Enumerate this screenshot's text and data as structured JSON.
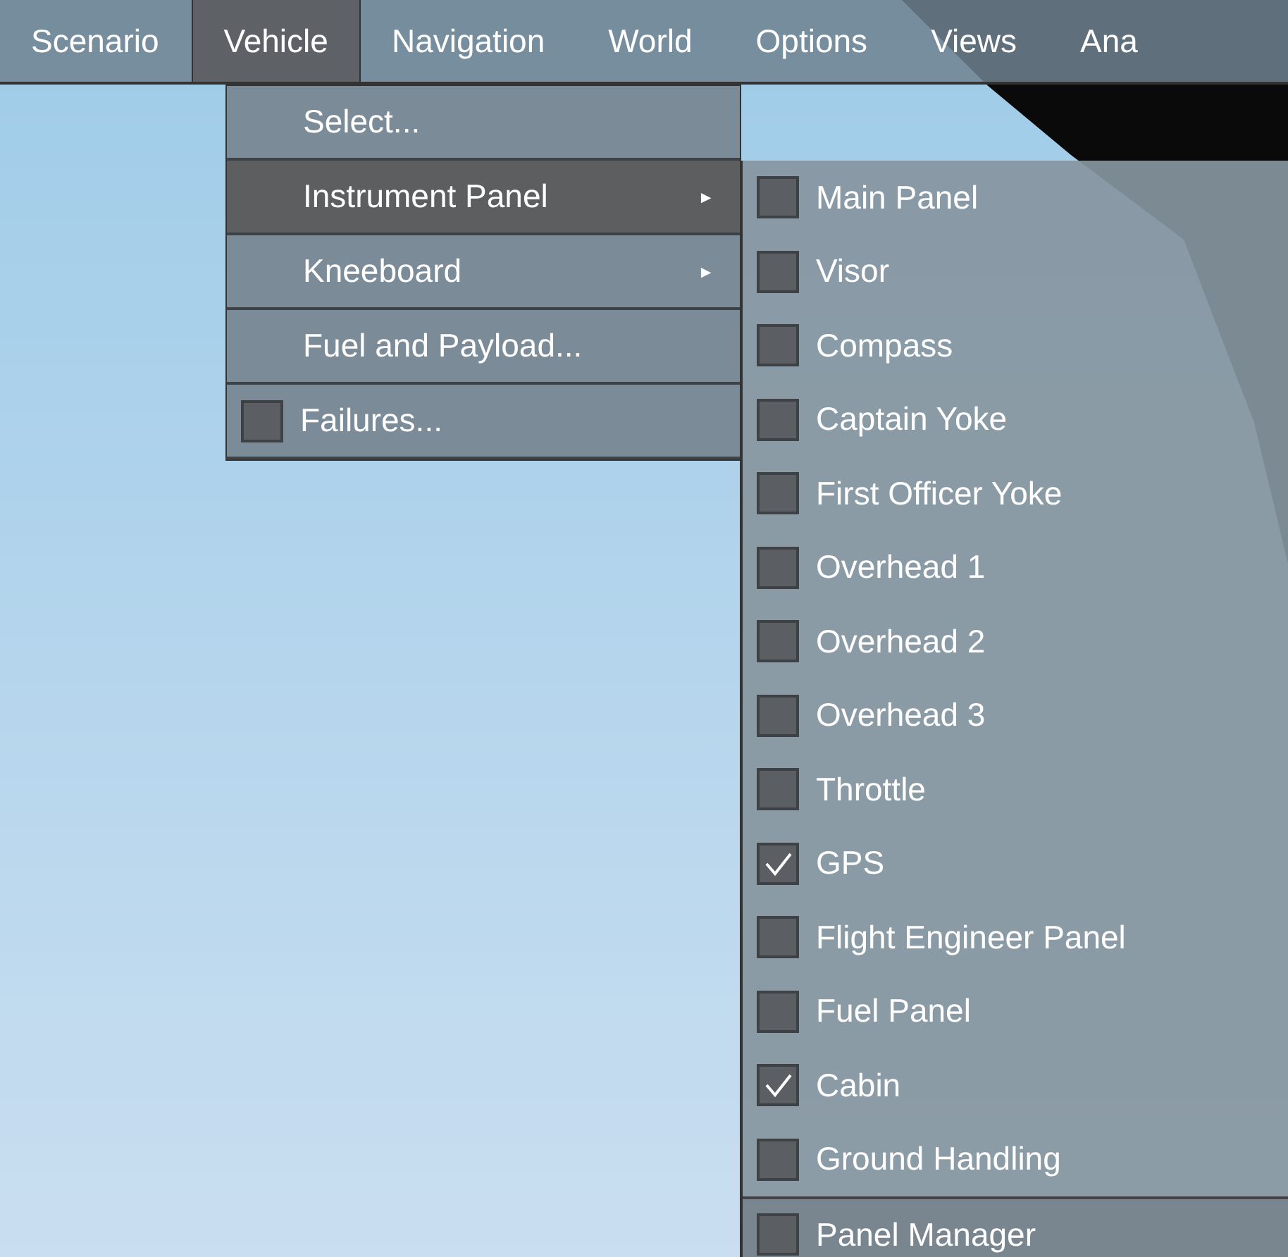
{
  "menu_bar": [
    {
      "label": "Scenario",
      "selected": false
    },
    {
      "label": "Vehicle",
      "selected": true
    },
    {
      "label": "Navigation",
      "selected": false
    },
    {
      "label": "World",
      "selected": false
    },
    {
      "label": "Options",
      "selected": false
    },
    {
      "label": "Views",
      "selected": false
    },
    {
      "label": "Ana",
      "selected": false
    }
  ],
  "vehicle_menu": [
    {
      "kind": "item",
      "label": "Select...",
      "selected": false
    },
    {
      "kind": "submenu",
      "label": "Instrument Panel",
      "selected": true,
      "arrow": "►"
    },
    {
      "kind": "submenu",
      "label": "Kneeboard",
      "selected": false,
      "arrow": "►"
    },
    {
      "kind": "item",
      "label": "Fuel and Payload...",
      "selected": false
    },
    {
      "kind": "check",
      "label": "Failures...",
      "selected": false,
      "checked": false
    }
  ],
  "instrument_panel_menu": [
    {
      "label": "Main Panel",
      "checked": false,
      "divider": false
    },
    {
      "label": "Visor",
      "checked": false,
      "divider": false
    },
    {
      "label": "Compass",
      "checked": false,
      "divider": false
    },
    {
      "label": "Captain Yoke",
      "checked": false,
      "divider": false
    },
    {
      "label": "First Officer Yoke",
      "checked": false,
      "divider": false
    },
    {
      "label": "Overhead 1",
      "checked": false,
      "divider": false
    },
    {
      "label": "Overhead 2",
      "checked": false,
      "divider": false
    },
    {
      "label": "Overhead 3",
      "checked": false,
      "divider": false
    },
    {
      "label": "Throttle",
      "checked": false,
      "divider": false
    },
    {
      "label": "GPS",
      "checked": true,
      "divider": false
    },
    {
      "label": "Flight Engineer Panel",
      "checked": false,
      "divider": false
    },
    {
      "label": "Fuel Panel",
      "checked": false,
      "divider": false
    },
    {
      "label": "Cabin",
      "checked": true,
      "divider": false
    },
    {
      "label": "Ground Handling",
      "checked": false,
      "divider": false
    },
    {
      "label": "Panel Manager",
      "checked": false,
      "divider": true
    }
  ]
}
